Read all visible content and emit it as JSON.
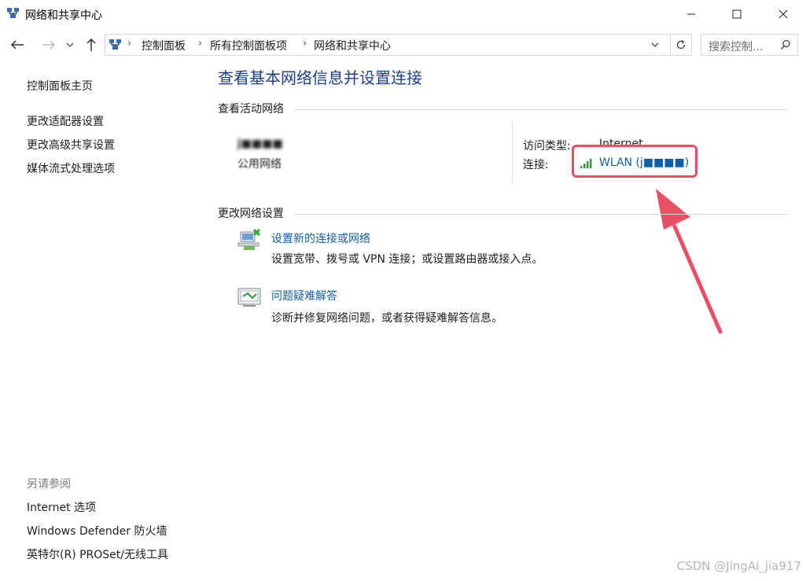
{
  "window": {
    "title": "网络和共享中心",
    "controls": {
      "minimize": "—",
      "maximize": "☐",
      "close": "✕"
    }
  },
  "nav": {
    "back_icon": "arrow-left-icon",
    "forward_icon": "arrow-right-icon",
    "recent_icon": "chevron-down-icon",
    "up_icon": "arrow-up-icon",
    "breadcrumbs": [
      "控制面板",
      "所有控制面板项",
      "网络和共享中心"
    ],
    "search_placeholder": "搜索控制..."
  },
  "sidebar": {
    "items": [
      {
        "label": "控制面板主页"
      },
      {
        "label": "更改适配器设置"
      },
      {
        "label": "更改高级共享设置"
      },
      {
        "label": "媒体流式处理选项"
      }
    ],
    "see_also_title": "另请参阅",
    "see_also_items": [
      {
        "label": "Internet 选项"
      },
      {
        "label": "Windows Defender 防火墙"
      },
      {
        "label": "英特尔(R) PROSet/无线工具"
      }
    ]
  },
  "main": {
    "title": "查看基本网络信息并设置连接",
    "active_networks": {
      "heading": "查看活动网络",
      "network_name": "j■■■■",
      "network_type": "公用网络",
      "access_type_label": "访问类型:",
      "access_type_value": "Internet",
      "connection_label": "连接:",
      "connection_value": "WLAN (j■■■■)"
    },
    "change_settings": {
      "heading": "更改网络设置",
      "items": [
        {
          "title": "设置新的连接或网络",
          "desc": "设置宽带、拨号或 VPN 连接；或设置路由器或接入点。",
          "icon": "new-connection-icon"
        },
        {
          "title": "问题疑难解答",
          "desc": "诊断并修复网络问题，或者获得疑难解答信息。",
          "icon": "troubleshoot-icon"
        }
      ]
    }
  },
  "annotation": {
    "color": "#ec4f64"
  },
  "watermark": "CSDN @JingAi_jia917",
  "colors": {
    "accent_title": "#1b3f8f",
    "link": "#0f5fa8"
  }
}
